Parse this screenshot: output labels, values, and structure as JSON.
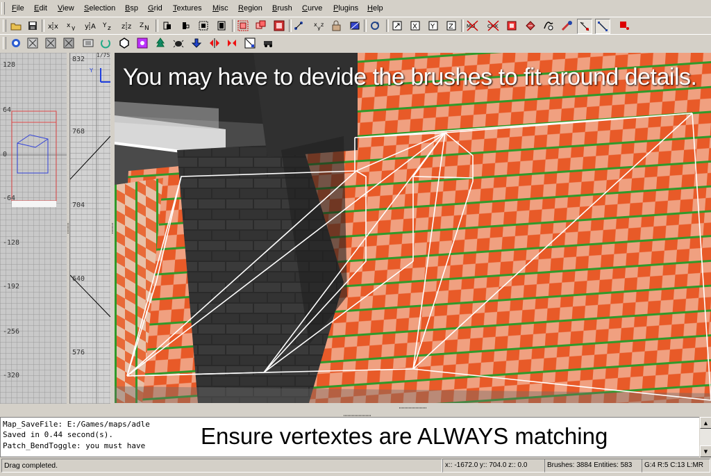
{
  "menu": [
    "File",
    "Edit",
    "View",
    "Selection",
    "Bsp",
    "Grid",
    "Textures",
    "Misc",
    "Region",
    "Brush",
    "Curve",
    "Plugins",
    "Help"
  ],
  "toolbar1_icons": [
    "open-icon",
    "save-icon",
    "flip-x-icon",
    "flip-y-icon",
    "flip-z-icon",
    "rotate-x-icon",
    "rotate-y-icon",
    "rotate-z-icon",
    "select-complete-tall-icon",
    "select-touching-icon",
    "select-partial-tall-icon",
    "select-inside-icon",
    "csg-subtract-icon",
    "csg-merge-icon",
    "make-hollow-icon",
    "clipper-icon",
    "change-views-icon",
    "texture-lock-icon",
    "cubic-clip-icon",
    "camera-icon",
    "view-x-icon",
    "view-y-icon",
    "view-z-icon",
    "show-patches-icon",
    "show-entities-icon",
    "hide-icon",
    "brush-primitive-icon",
    "entity-icon",
    "patch-icon",
    "drag-edges-icon",
    "drag-vertices-icon",
    "filter-icon"
  ],
  "toolbar2_icons": [
    "refresh-icon",
    "texture-scale-icon",
    "texture-rotate-icon",
    "texture-fit-icon",
    "texture-natural-icon",
    "cone-icon",
    "surface-inspector-icon",
    "entity-list-icon",
    "tree-icon",
    "bug-icon",
    "arrow-down-icon",
    "mirror-x-icon",
    "mirror-y-icon",
    "no-draw-icon",
    "rally-icon"
  ],
  "side_view": {
    "labels": [
      "128",
      "64",
      "0",
      "-64",
      "-128",
      "-192",
      "-256",
      "-320"
    ]
  },
  "z_view": {
    "labels": [
      "832",
      "768",
      "704",
      "640",
      "576"
    ],
    "top_extra": "1/75"
  },
  "camera": {
    "caption": "You may have to devide the brushes to fit around details."
  },
  "console": {
    "lines": [
      "Map_SaveFile: E:/Games/maps/adle",
      "Saved in 0.44 second(s).",
      "Patch_BendToggle: you must have"
    ],
    "overlay_text": "Ensure vertextes are ALWAYS matching"
  },
  "status": {
    "message": "Drag completed.",
    "coords": "x:: -1672.0  y:: 704.0  z:: 0.0",
    "counts": "Brushes: 3884  Entities: 583",
    "grid": "G:4  R:5  C:13  L:MR"
  }
}
